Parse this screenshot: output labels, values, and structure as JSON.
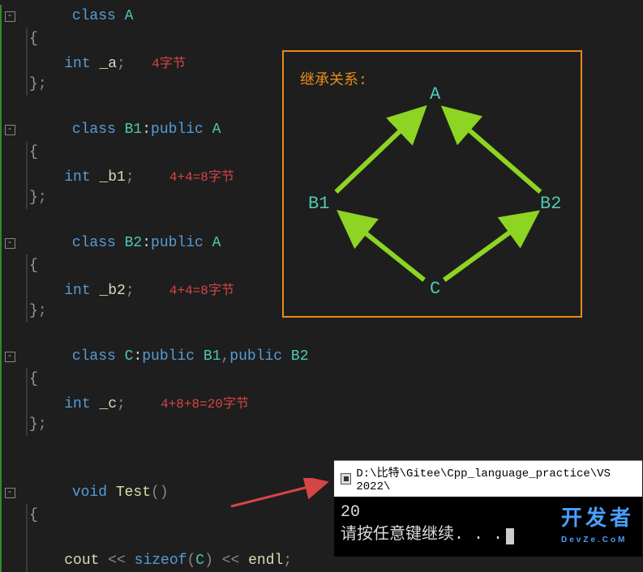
{
  "gutter": {
    "fold": "-"
  },
  "code": {
    "classA": {
      "kw": "class ",
      "name": "A"
    },
    "fieldA": {
      "type": "int ",
      "name": "_a",
      "annot": "4字节"
    },
    "classB1": {
      "kw": "class ",
      "name": "B1",
      "colon": ":",
      "public": "public ",
      "base": "A"
    },
    "fieldB1": {
      "type": "int ",
      "name": "_b1",
      "annot": "4+4=8字节"
    },
    "classB2": {
      "kw": "class ",
      "name": "B2",
      "colon": ":",
      "public": "public ",
      "base": "A"
    },
    "fieldB2": {
      "type": "int ",
      "name": "_b2",
      "annot": "4+4=8字节"
    },
    "classC": {
      "kw": "class ",
      "name": "C",
      "colon": ":",
      "public": "public ",
      "base1": "B1",
      "comma": ",",
      "base2": "B2"
    },
    "fieldC": {
      "type": "int ",
      "name": "_c",
      "annot": "4+8+8=20字节"
    },
    "test": {
      "ret": "void ",
      "name": "Test",
      "parens": "()"
    },
    "stmt": {
      "cout": "cout",
      "op": " << ",
      "sizeof": "sizeof",
      "lp": "(",
      "arg": "C",
      "rp": ")",
      "endl": "endl"
    },
    "brace_open": "{",
    "brace_close": "}",
    "brace_close_semi": ";",
    "semi": ";"
  },
  "diagram": {
    "title": "继承关系:",
    "nodes": {
      "A": "A",
      "B1": "B1",
      "B2": "B2",
      "C": "C"
    }
  },
  "console": {
    "title": "D:\\比特\\Gitee\\Cpp_language_practice\\VS 2022\\",
    "output_line1": "20",
    "output_line2": "请按任意键继续. . ."
  },
  "watermark": {
    "main": "开发者",
    "sub": "DevZe.CoM"
  },
  "chart_data": {
    "type": "diagram",
    "title": "继承关系",
    "nodes": [
      "A",
      "B1",
      "B2",
      "C"
    ],
    "edges": [
      {
        "from": "B1",
        "to": "A"
      },
      {
        "from": "B2",
        "to": "A"
      },
      {
        "from": "C",
        "to": "B1"
      },
      {
        "from": "C",
        "to": "B2"
      }
    ],
    "sizes": {
      "A": 4,
      "B1": 8,
      "B2": 8,
      "C": 20
    }
  }
}
